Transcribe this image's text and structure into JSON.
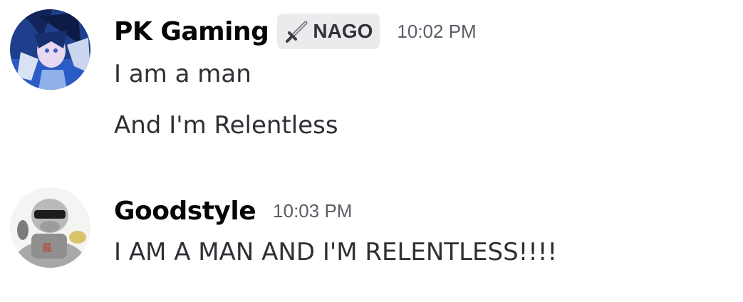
{
  "messages": [
    {
      "author": "PK Gaming",
      "tag": "NAGO",
      "tag_icon": "sword-icon",
      "timestamp": "10:02 PM",
      "avatar": "anime-character-avatar",
      "lines": [
        "I am a man",
        "And I'm Relentless"
      ]
    },
    {
      "author": "Goodstyle",
      "timestamp": "10:03 PM",
      "avatar": "cartoon-character-avatar",
      "lines": [
        "I AM A MAN AND I'M RELENTLESS!!!!"
      ]
    }
  ],
  "colors": {
    "username": "#060607",
    "message_text": "#2e3035",
    "timestamp": "#5c5e66",
    "tag_background": "#ebebed"
  }
}
